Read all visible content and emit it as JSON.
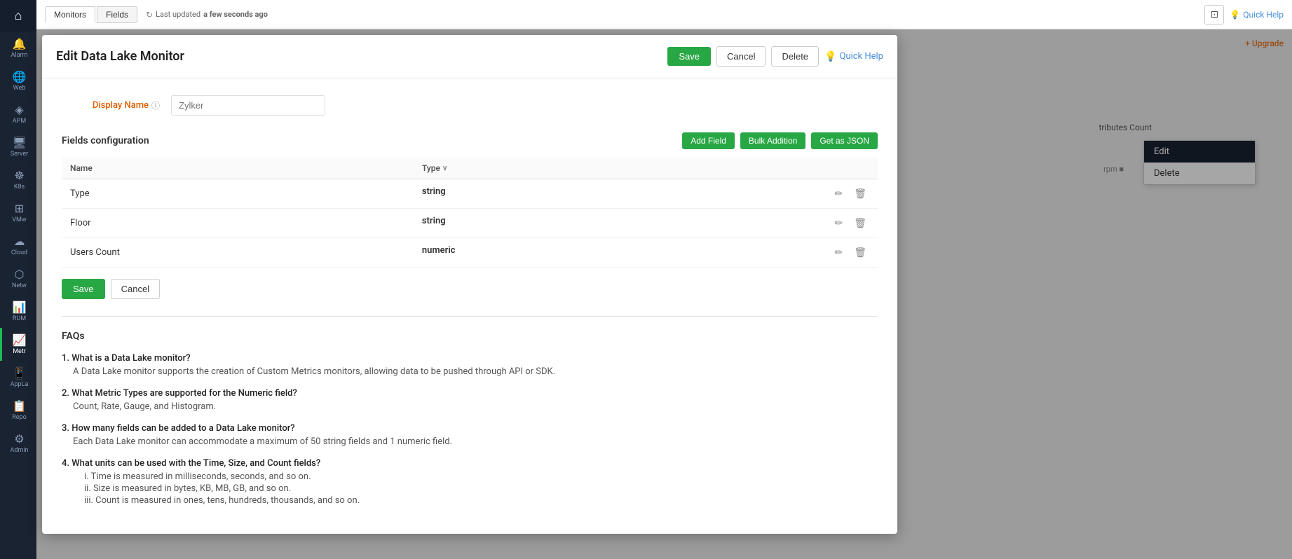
{
  "sidebar": {
    "items": [
      {
        "label": "Home",
        "icon": "⌂"
      },
      {
        "label": "Alarm",
        "icon": "🔔"
      },
      {
        "label": "Web",
        "icon": "🌐"
      },
      {
        "label": "APM",
        "icon": "◈"
      },
      {
        "label": "Server",
        "icon": "🖥"
      },
      {
        "label": "K8s",
        "icon": "☸"
      },
      {
        "label": "VMw",
        "icon": "⊞"
      },
      {
        "label": "Cloud",
        "icon": "☁"
      },
      {
        "label": "Netw",
        "icon": "⬡"
      },
      {
        "label": "RUM",
        "icon": "📊"
      },
      {
        "label": "Metr",
        "icon": "📈"
      },
      {
        "label": "AppLa",
        "icon": "📱"
      },
      {
        "label": "Repo",
        "icon": "📋"
      },
      {
        "label": "Admin",
        "icon": "⚙"
      }
    ]
  },
  "top_bar": {
    "tabs": [
      {
        "label": "Monitors",
        "active": true
      },
      {
        "label": "Fields",
        "active": false
      }
    ],
    "last_updated": "Last updated",
    "last_updated_time": "a few seconds ago"
  },
  "header": {
    "quick_help": "Quick Help",
    "upgrade": "+ Upgrade"
  },
  "modal": {
    "title": "Edit Data Lake Monitor",
    "save_label": "Save",
    "cancel_label": "Cancel",
    "delete_label": "Delete",
    "quick_help_label": "Quick Help",
    "display_name_label": "Display Name",
    "display_name_placeholder": "Zylker",
    "fields_config_title": "Fields configuration",
    "add_field_label": "Add Field",
    "bulk_addition_label": "Bulk Addition",
    "get_json_label": "Get as JSON",
    "table_headers": {
      "name": "Name",
      "type": "Type"
    },
    "fields": [
      {
        "name": "Type",
        "type": "string"
      },
      {
        "name": "Floor",
        "type": "string"
      },
      {
        "name": "Users Count",
        "type": "numeric"
      }
    ],
    "bottom_save": "Save",
    "bottom_cancel": "Cancel",
    "faqs": {
      "title": "FAQs",
      "items": [
        {
          "question": "1. What is a Data Lake monitor?",
          "answer": "A Data Lake monitor supports the creation of Custom Metrics monitors, allowing data to be pushed through API or SDK."
        },
        {
          "question": "2. What Metric Types are supported for the Numeric field?",
          "answer": "Count, Rate, Gauge, and Histogram."
        },
        {
          "question": "3. How many fields can be added to a Data Lake monitor?",
          "answer": "Each Data Lake monitor can accommodate a maximum of 50 string fields and 1 numeric field."
        },
        {
          "question": "4. What units can be used with the Time, Size, and Count fields?",
          "sub_answers": [
            "i.  Time is measured in milliseconds, seconds, and so on.",
            "ii.  Size is measured in bytes, KB, MB, GB, and so on.",
            "iii.  Count is measured in ones, tens, hundreds, thousands, and so on."
          ]
        }
      ]
    }
  },
  "context_menu": {
    "items": [
      {
        "label": "Edit"
      },
      {
        "label": "Delete"
      }
    ]
  },
  "right_panel": {
    "col_label": "tributes Count",
    "col_mini": "rpm ■"
  },
  "colors": {
    "green": "#28a745",
    "sidebar_bg": "#1a2332",
    "accent_orange": "#e05c00",
    "link_blue": "#4a90d9"
  }
}
